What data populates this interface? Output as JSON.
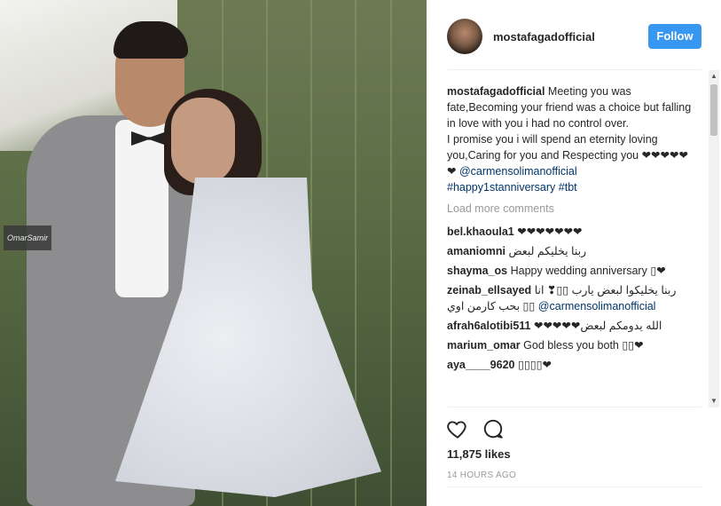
{
  "photo": {
    "watermark": "OmarSamir"
  },
  "post": {
    "username": "mostafagadofficial",
    "follow_label": "Follow",
    "caption": {
      "username": "mostafagadofficial",
      "text": "Meeting you was fate,Becoming your friend was a choice but falling in love with you i had no control over.",
      "text2": "I promise you i will spend an eternity loving you,Caring for you and Respecting you ❤❤❤❤❤❤",
      "mention": "@carmensolimanofficial",
      "hashtag1": "#happy1stanniversary",
      "hashtag2": "#tbt"
    },
    "load_more": "Load more comments",
    "comments": [
      {
        "user": "bel.khaoula1",
        "text": "❤❤❤❤❤❤❤"
      },
      {
        "user": "amaniomni",
        "text": "ربنا يخليكم لبعض"
      },
      {
        "user": "shayma_os",
        "text": "Happy wedding anniversary ▯❤"
      },
      {
        "user": "zeinab_ellsayed",
        "text": "ربنا يخليكوا لبعض يارب ▯▯❣ انا بحب كارمن اوي ▯▯",
        "mention": "@carmensolimanofficial"
      },
      {
        "user": "afrah6alotibi511",
        "text": "❤❤❤❤❤الله يدومكم لبعض"
      },
      {
        "user": "marium_omar",
        "text": "God bless you both ▯▯❤"
      },
      {
        "user": "aya____9620",
        "text": "▯▯▯▯❤"
      }
    ],
    "likes": "11,875 likes",
    "time": "14 HOURS AGO",
    "icons": {
      "like": "heart-icon",
      "comment": "comment-icon"
    }
  },
  "colors": {
    "follow": "#3897f0",
    "link": "#003569",
    "muted": "#999999"
  }
}
